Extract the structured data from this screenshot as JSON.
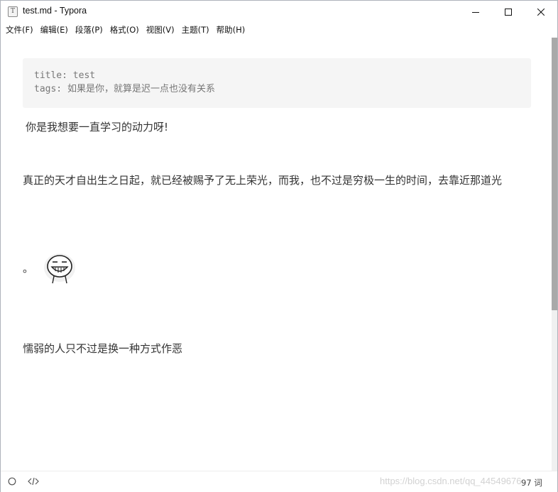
{
  "window": {
    "title": "test.md - Typora",
    "app_icon_letter": "T"
  },
  "menu": [
    {
      "label": "文件(F)"
    },
    {
      "label": "编辑(E)"
    },
    {
      "label": "段落(P)"
    },
    {
      "label": "格式(O)"
    },
    {
      "label": "视图(V)"
    },
    {
      "label": "主题(T)"
    },
    {
      "label": "帮助(H)"
    }
  ],
  "front_matter": {
    "title_key": "title: ",
    "title_value": "test",
    "tags_key": "tags: ",
    "tags_value": "如果是你，就算是迟一点也没有关系"
  },
  "content": {
    "p1": "你是我想要一直学习的动力呀!",
    "p2": "真正的天才自出生之日起，就已经被赐予了无上荣光，而我，也不过是穷极一生的时间，去靠近那道光",
    "p3_text": "。",
    "p3_image": "grinning-face-sticker",
    "p4": "懦弱的人只不过是换一种方式作恶"
  },
  "status": {
    "word_count": "97 词",
    "watermark": "https://blog.csdn.net/qq_44549676"
  },
  "icons": {
    "minimize": "minimize-icon",
    "maximize": "maximize-icon",
    "close": "close-icon",
    "status_circle": "circle-icon",
    "source_code": "code-icon"
  },
  "colors": {
    "frontmatter_bg": "#f5f5f5",
    "scroll_thumb": "#a9a9a9",
    "watermark": "#d2d2d2"
  }
}
